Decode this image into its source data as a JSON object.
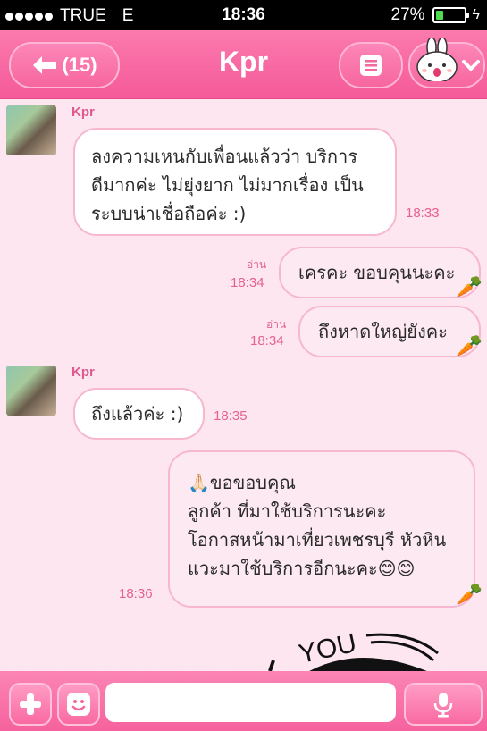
{
  "status_bar": {
    "signal": "●●●●●",
    "carrier": "TRUE",
    "network": "E",
    "time": "18:36",
    "battery_percent": "27%",
    "battery_level": 0.27
  },
  "nav": {
    "back_label": "(15)",
    "title": "Kpr",
    "menu_icon": "list-icon",
    "sticker_icon": "bunny-sticker-icon"
  },
  "messages": [
    {
      "direction": "in",
      "sender": "Kpr",
      "lines": [
        "ลงความเหนกับเพื่อนแล้วว่า บริการ",
        "ดีมากค่ะ ไม่ยุ่งยาก ไม่มากเรื่อง เป็น",
        "ระบบน่าเชื่อถือค่ะ :)"
      ],
      "time": "18:33"
    },
    {
      "direction": "out",
      "read": "อ่าน",
      "text": "เครคะ ขอบคุนนะคะ",
      "time": "18:34"
    },
    {
      "direction": "out",
      "read": "อ่าน",
      "text": "ถึงหาดใหญ่ยังคะ",
      "time": "18:34"
    },
    {
      "direction": "in",
      "sender": "Kpr",
      "text": "ถึงแล้วค่ะ :)",
      "time": "18:35"
    },
    {
      "direction": "out",
      "lines": [
        "🙏🏻ขอขอบคุณ",
        "ลูกค้า ที่มาใช้บริการนะคะ",
        "โอกาสหน้ามาเที่ยวเพชรบุรี หัวหิน",
        "แวะมาใช้บริการอีกนะคะ😊😊"
      ],
      "time": "18:36"
    }
  ],
  "sticker_text": "YOU",
  "input": {
    "placeholder": ""
  },
  "colors": {
    "accent": "#f55a99",
    "bubble_border": "#f6b7cf",
    "timestamp": "#e5628f"
  }
}
